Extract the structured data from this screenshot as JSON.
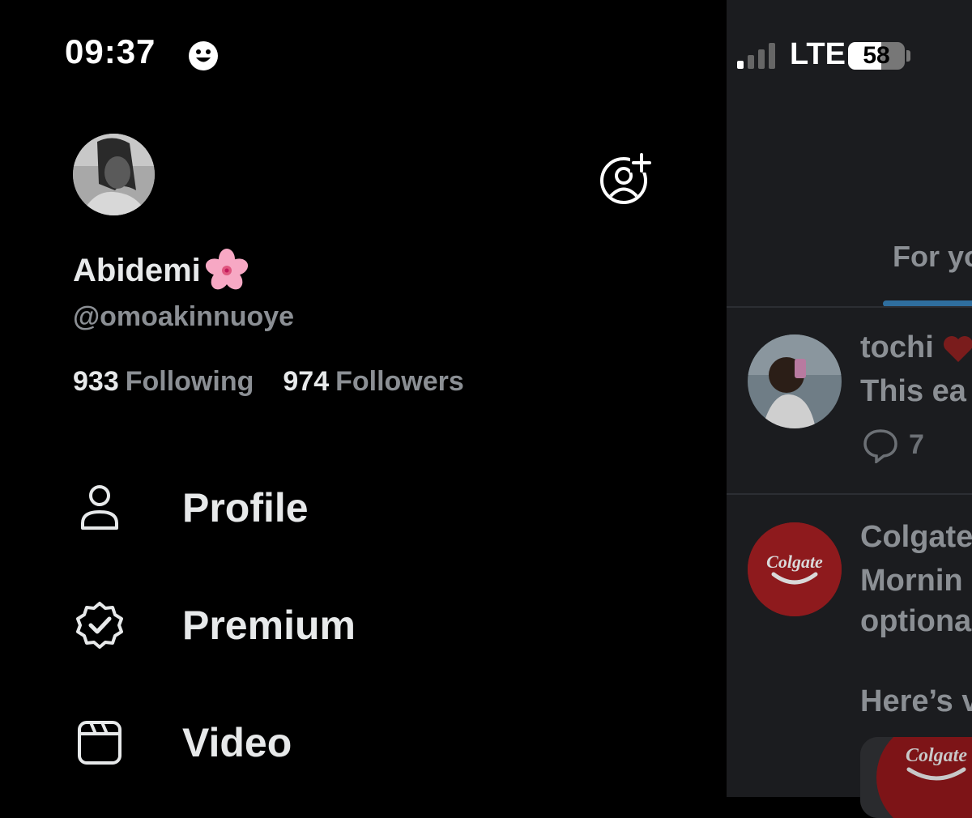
{
  "status_bar": {
    "time": "09:37",
    "network": "LTE",
    "battery": "58",
    "battery_level": 0.58
  },
  "drawer": {
    "display_name": "Abidemi",
    "name_emoji": "cherry-blossom-icon",
    "handle": "@omoakinnuoye",
    "following_count": "933",
    "following_label": "Following",
    "followers_count": "974",
    "followers_label": "Followers",
    "menu": [
      {
        "label": "Profile",
        "icon": "person-icon"
      },
      {
        "label": "Premium",
        "icon": "verified-badge-icon"
      },
      {
        "label": "Video",
        "icon": "video-clapper-icon"
      }
    ]
  },
  "feed": {
    "tab_label": "For yo",
    "posts": [
      {
        "author": "tochi",
        "text": "This ea",
        "reply_count": "7"
      },
      {
        "author": "Colgate",
        "text_lines": [
          "Mornin",
          "optiona"
        ],
        "logo_text": "Colgate"
      }
    ],
    "promo_text": "Here’s v"
  },
  "colors": {
    "drawer_bg": "#000000",
    "feed_bg": "#1b1c1f",
    "primary_text": "#e7e9ea",
    "secondary_text": "#8b8f94",
    "tab_indicator": "#2f6e9e",
    "colgate_red": "#c4161c"
  }
}
